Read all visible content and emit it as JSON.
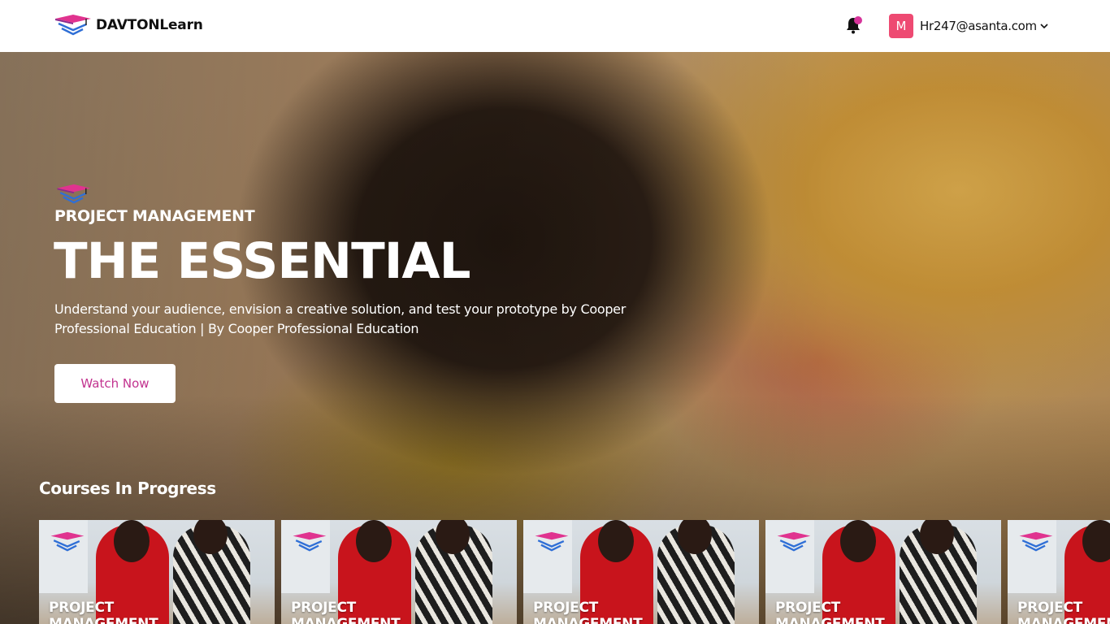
{
  "header": {
    "brand_name": "DAVTONLearn",
    "avatar_initial": "M",
    "user_email": "Hr247@asanta.com",
    "notification_color": "#d6339a",
    "avatar_color": "#ee4a72"
  },
  "hero": {
    "kicker": "PROJECT MANAGEMENT",
    "title": "THE ESSENTIAL",
    "description": "Understand your audience, envision a creative solution, and test your prototype by Cooper Professional Education | By Cooper Professional Education",
    "watch_button": "Watch Now",
    "accent_color": "#c2338f"
  },
  "courses_in_progress": {
    "title": "Courses In Progress",
    "cards": [
      {
        "title": "PROJECT MANAGEMENT"
      },
      {
        "title": "PROJECT MANAGEMENT"
      },
      {
        "title": "PROJECT MANAGEMENT"
      },
      {
        "title": "PROJECT MANAGEMENT"
      },
      {
        "title": "PROJECT MANAGEMENT"
      }
    ]
  }
}
